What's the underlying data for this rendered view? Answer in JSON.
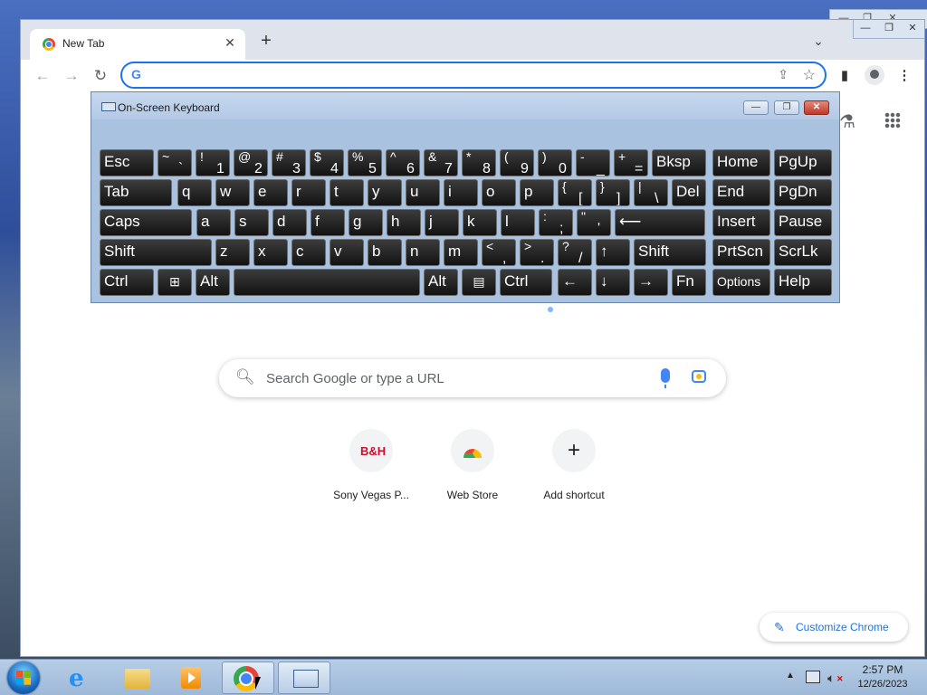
{
  "browser": {
    "tab": {
      "title": "New Tab"
    },
    "omnibox": {
      "value": ""
    },
    "ntp": {
      "search_placeholder": "Search Google or type a URL",
      "shortcuts": [
        {
          "label": "Sony Vegas P...",
          "icon": "bh-logo-icon",
          "logo_text": "B&H"
        },
        {
          "label": "Web Store",
          "icon": "web-store-icon"
        },
        {
          "label": "Add shortcut",
          "icon": "plus-icon",
          "glyph": "+"
        }
      ],
      "customize_label": "Customize Chrome"
    },
    "colors": {
      "accent": "#1a73e8"
    }
  },
  "osk": {
    "title": "On-Screen Keyboard",
    "rows": [
      [
        {
          "label": "Esc"
        },
        {
          "up": "~",
          "down": "`"
        },
        {
          "up": "!",
          "down": "1"
        },
        {
          "up": "@",
          "down": "2"
        },
        {
          "up": "#",
          "down": "3"
        },
        {
          "up": "$",
          "down": "4"
        },
        {
          "up": "%",
          "down": "5"
        },
        {
          "up": "^",
          "down": "6"
        },
        {
          "up": "&",
          "down": "7"
        },
        {
          "up": "*",
          "down": "8"
        },
        {
          "up": "(",
          "down": "9"
        },
        {
          "up": ")",
          "down": "0"
        },
        {
          "up": "-",
          "down": "_"
        },
        {
          "up": "+",
          "down": "="
        },
        {
          "label": "Bksp"
        },
        {
          "label": "Home"
        },
        {
          "label": "PgUp"
        }
      ],
      [
        {
          "label": "Tab"
        },
        {
          "label": "q"
        },
        {
          "label": "w"
        },
        {
          "label": "e"
        },
        {
          "label": "r"
        },
        {
          "label": "t"
        },
        {
          "label": "y"
        },
        {
          "label": "u"
        },
        {
          "label": "i"
        },
        {
          "label": "o"
        },
        {
          "label": "p"
        },
        {
          "up": "{",
          "down": "["
        },
        {
          "up": "}",
          "down": "]"
        },
        {
          "up": "|",
          "down": "\\"
        },
        {
          "label": "Del"
        },
        {
          "label": "End"
        },
        {
          "label": "PgDn"
        }
      ],
      [
        {
          "label": "Caps"
        },
        {
          "label": "a"
        },
        {
          "label": "s"
        },
        {
          "label": "d"
        },
        {
          "label": "f"
        },
        {
          "label": "g"
        },
        {
          "label": "h"
        },
        {
          "label": "j"
        },
        {
          "label": "k"
        },
        {
          "label": "l"
        },
        {
          "up": ":",
          "down": ";"
        },
        {
          "up": "\"",
          "down": "'"
        },
        {
          "label": "⟵"
        },
        {
          "label": "Insert"
        },
        {
          "label": "Pause"
        }
      ],
      [
        {
          "label": "Shift"
        },
        {
          "label": "z"
        },
        {
          "label": "x"
        },
        {
          "label": "c"
        },
        {
          "label": "v"
        },
        {
          "label": "b"
        },
        {
          "label": "n"
        },
        {
          "label": "m"
        },
        {
          "up": "<",
          "down": ","
        },
        {
          "up": ">",
          "down": "."
        },
        {
          "up": "?",
          "down": "/"
        },
        {
          "label": "↑"
        },
        {
          "label": "Shift"
        },
        {
          "label": "PrtScn"
        },
        {
          "label": "ScrLk"
        }
      ],
      [
        {
          "label": "Ctrl"
        },
        {
          "label": "⊞"
        },
        {
          "label": "Alt"
        },
        {
          "label": ""
        },
        {
          "label": "Alt"
        },
        {
          "label": "▤"
        },
        {
          "label": "Ctrl"
        },
        {
          "label": "←"
        },
        {
          "label": "↓"
        },
        {
          "label": "→"
        },
        {
          "label": "Fn"
        },
        {
          "label": "Options"
        },
        {
          "label": "Help"
        }
      ]
    ]
  },
  "taskbar": {
    "clock_time": "2:57 PM",
    "clock_date": "12/26/2023",
    "apps": [
      "start-orb",
      "internet-explorer-icon",
      "file-explorer-icon",
      "media-player-icon",
      "chrome-icon",
      "on-screen-keyboard-icon"
    ]
  }
}
